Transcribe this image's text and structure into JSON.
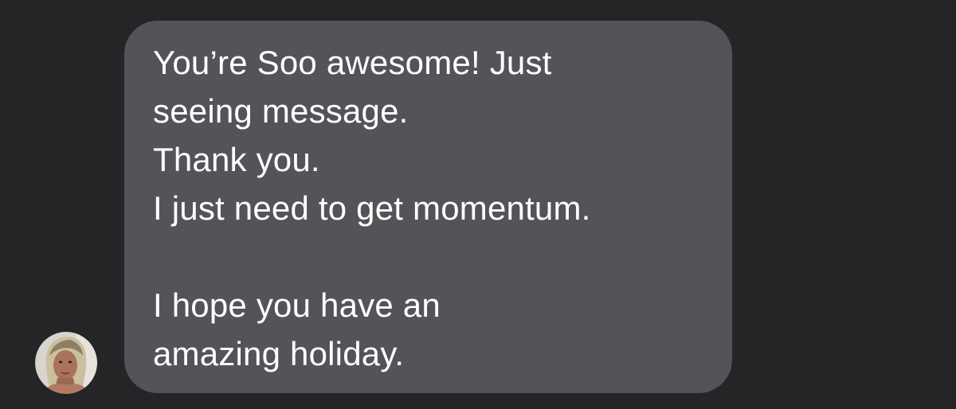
{
  "conversation": {
    "incoming_message": {
      "text": "You’re Soo awesome! Just\nseeing message.\nThank you.\nI just need to get momentum.\n\nI hope you have an\namazing holiday.",
      "bubble_color": "#545458",
      "text_color": "#ffffff"
    },
    "sender_avatar": {
      "icon": "profile-photo"
    },
    "background_color": "#252527"
  }
}
